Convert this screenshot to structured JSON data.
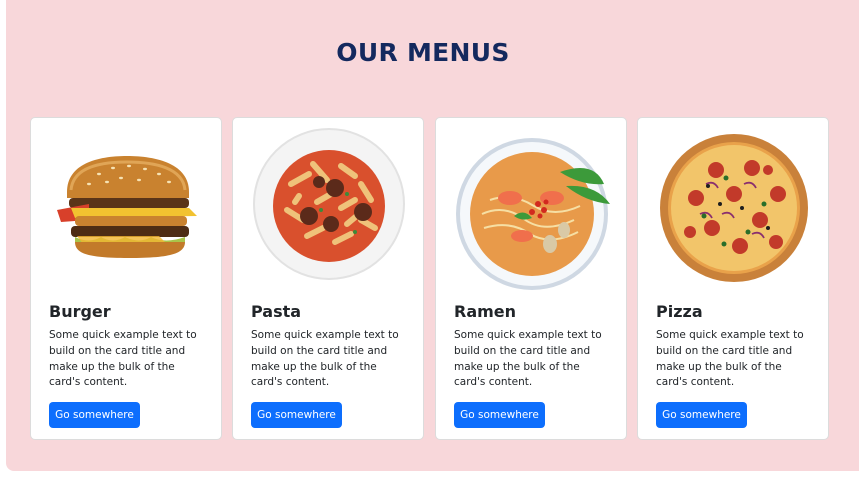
{
  "section": {
    "title": "OUR MENUS",
    "background_color": "#f8d7da",
    "title_color": "#14295e"
  },
  "button_color": "#0d6efd",
  "cards": [
    {
      "title": "Burger",
      "text": "Some quick example text to build on the card title and make up the bulk of the card's content.",
      "button_label": "Go somewhere",
      "image": "burger-image"
    },
    {
      "title": "Pasta",
      "text": "Some quick example text to build on the card title and make up the bulk of the card's content.",
      "button_label": "Go somewhere",
      "image": "pasta-image"
    },
    {
      "title": "Ramen",
      "text": "Some quick example text to build on the card title and make up the bulk of the card's content.",
      "button_label": "Go somewhere",
      "image": "ramen-image"
    },
    {
      "title": "Pizza",
      "text": "Some quick example text to build on the card title and make up the bulk of the card's content.",
      "button_label": "Go somewhere",
      "image": "pizza-image"
    }
  ]
}
